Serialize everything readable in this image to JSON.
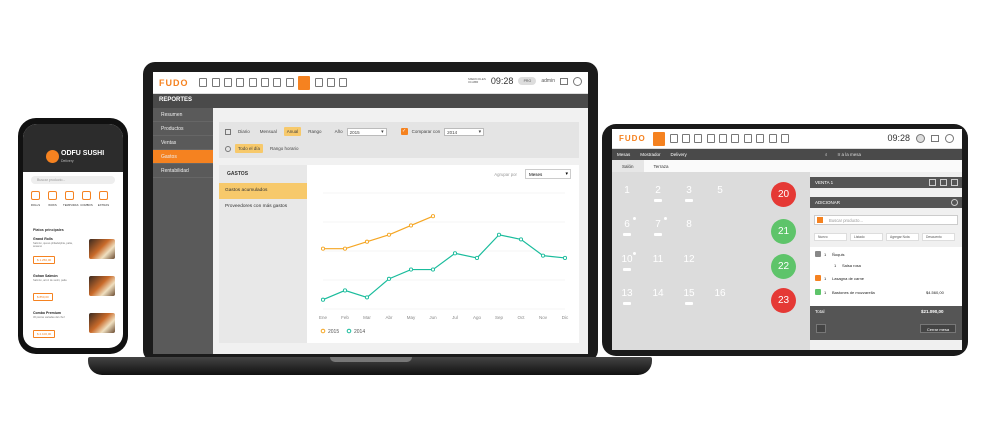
{
  "laptop": {
    "logo": "FUDO",
    "time": "09:28",
    "date_label": "MIERCOLES\n04 ABR",
    "user": "admin",
    "pill_label": "PRO",
    "section_title": "REPORTES",
    "sidebar": [
      "Resumen",
      "Productos",
      "Ventas",
      "Gastos",
      "Rentabilidad"
    ],
    "sidebar_active": 3,
    "filters": {
      "periods": [
        "Diario",
        "Mensual",
        "Anual",
        "Rango"
      ],
      "active_period": "Anual",
      "year_label": "Año",
      "year_value": "2015",
      "compare_label": "Comparar con",
      "compare_value": "2014",
      "scope_options": [
        "Todo el día",
        "Rango horario"
      ],
      "active_scope": "Todo el día"
    },
    "gastos": {
      "title": "GASTOS",
      "items": [
        "Gastos acumulados",
        "Proveedores con más gastos"
      ],
      "active_item": 0,
      "group_label": "Agrupar por",
      "group_value": "Meses"
    }
  },
  "chart_data": {
    "type": "line",
    "categories": [
      "Ene",
      "Feb",
      "Mar",
      "Abr",
      "May",
      "Jun",
      "Jul",
      "Ago",
      "Sep",
      "Oct",
      "Nov",
      "Dic"
    ],
    "series": [
      {
        "name": "2015",
        "color": "#f5a623",
        "values": [
          52,
          52,
          58,
          64,
          72,
          80
        ]
      },
      {
        "name": "2014",
        "color": "#1abc9c",
        "values": [
          8,
          16,
          10,
          26,
          34,
          34,
          48,
          44,
          64,
          60,
          46,
          44
        ]
      }
    ],
    "ylim": [
      0,
      100
    ],
    "grid": true,
    "legend": "bottom-left"
  },
  "phone": {
    "restaurant": "ODFU SUSHI",
    "subtitle": "Delivery",
    "search_placeholder": "Buscar producto...",
    "categories": [
      "ROLLS",
      "WOKS",
      "TEMPURAS",
      "COMBOS",
      "EXTRAS"
    ],
    "section": "Platos principales",
    "plates": [
      {
        "name": "Grand Rolls",
        "desc": "Salmón, queso philadelphia, palta, sésamo",
        "price": "$ 1.250,00"
      },
      {
        "name": "Gohan Salmón",
        "desc": "Salmón, arroz de sushi, palta",
        "price": "$ 850,00"
      },
      {
        "name": "Combo Premium",
        "desc": "30 piezas variadas del chef",
        "price": "$ 2.100,00"
      }
    ]
  },
  "tablet": {
    "logo": "FUDO",
    "time": "09:28",
    "nav": [
      "Mesas",
      "Mostrador",
      "Delivery"
    ],
    "go_to_table": "Ir a la mesa",
    "tabs": [
      "Salón",
      "Terraza"
    ],
    "active_tab": "Salón",
    "tables_square": [
      {
        "num": "1",
        "state": "g"
      },
      {
        "num": "2",
        "state": "r"
      },
      {
        "num": "3",
        "state": "r"
      },
      {
        "num": "5",
        "state": "g"
      },
      {
        "num": "6",
        "state": "b"
      },
      {
        "num": "7",
        "state": "r"
      },
      {
        "num": "8",
        "state": "g"
      },
      {
        "num": "10",
        "state": "r"
      },
      {
        "num": "11",
        "state": "g"
      },
      {
        "num": "12",
        "state": "g"
      },
      {
        "num": "13",
        "state": "r"
      },
      {
        "num": "14",
        "state": "g"
      },
      {
        "num": "15",
        "state": "r"
      },
      {
        "num": "16",
        "state": "g"
      }
    ],
    "tables_round": [
      {
        "num": "20",
        "state": "r"
      },
      {
        "num": "21",
        "state": "g"
      },
      {
        "num": "22",
        "state": "g"
      },
      {
        "num": "23",
        "state": "r"
      }
    ],
    "venta": "VENTA 1",
    "adicionar": "ADICIONAR",
    "search_placeholder": "Buscar producto...",
    "quick_buttons": [
      "Nuevo",
      "Listado",
      "Agregar Nota",
      "Descuento"
    ],
    "orders": [
      {
        "qty": "1",
        "name": "Ñoquis",
        "price": "",
        "color": "#888"
      },
      {
        "qty": "1",
        "name": "Salsa rosa",
        "price": "",
        "color": "#ffffff"
      },
      {
        "qty": "1",
        "name": "Lasagna de carne",
        "price": "",
        "color": "#f58220"
      },
      {
        "qty": "1",
        "name": "Bastones de mozzarella",
        "price": "$4.560,00",
        "color": "#5ec46a"
      }
    ],
    "total_label": "Total",
    "total_value": "$21.090,00",
    "close_button": "Cerrar mesa"
  }
}
